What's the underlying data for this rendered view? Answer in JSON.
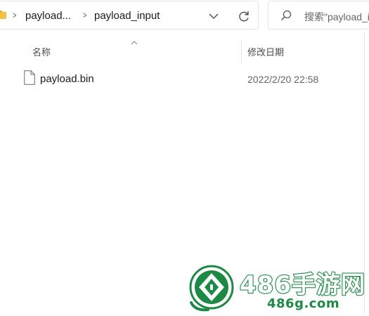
{
  "address_bar": {
    "breadcrumbs": [
      "payload...",
      "payload_input"
    ],
    "folder_icon": "folder-icon",
    "dropdown_icon": "chevron-down-icon",
    "refresh_icon": "refresh-icon"
  },
  "search": {
    "placeholder": "搜索\"payload_input\"",
    "icon": "search-icon"
  },
  "columns": {
    "name": "名称",
    "modified": "修改日期",
    "sort_icon": "sort-up-icon"
  },
  "files": [
    {
      "name": "payload.bin",
      "modified": "2022/2/20 22:58",
      "icon": "file-icon"
    }
  ],
  "watermark": {
    "title": "486手游网",
    "subtitle": "486g.com",
    "logo": "486-logo"
  },
  "colors": {
    "watermark_green": "#1c8a45",
    "folder_yellow": "#f5c143"
  }
}
